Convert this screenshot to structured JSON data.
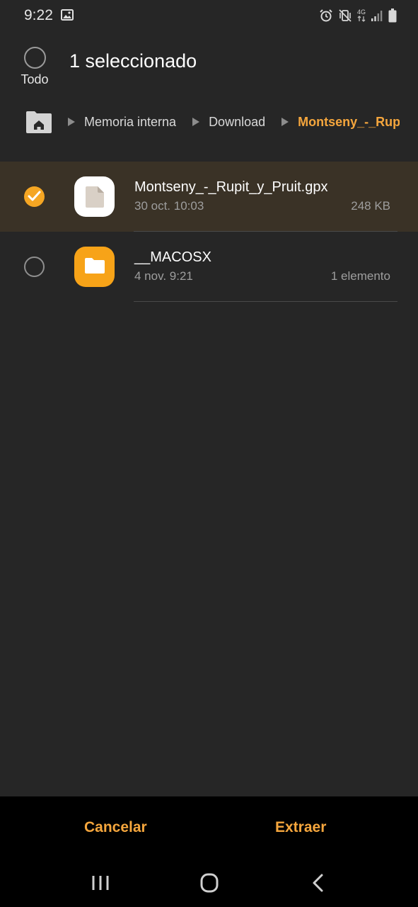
{
  "status_bar": {
    "time": "9:22",
    "network_label": "4G",
    "icons": [
      "image-icon",
      "alarm-icon",
      "vibrate-icon",
      "signal-icon",
      "battery-icon"
    ]
  },
  "header": {
    "select_all_label": "Todo",
    "title": "1 seleccionado"
  },
  "breadcrumb": {
    "items": [
      "Memoria interna",
      "Download",
      "Montseny_-_Rupit"
    ]
  },
  "files": [
    {
      "name": "Montseny_-_Rupit_y_Pruit.gpx",
      "date": "30 oct. 10:03",
      "meta": "248 KB",
      "type": "file",
      "selected": true
    },
    {
      "name": "__MACOSX",
      "date": "4 nov. 9:21",
      "meta": "1 elemento",
      "type": "folder",
      "selected": false
    }
  ],
  "actions": {
    "cancel": "Cancelar",
    "extract": "Extraer"
  },
  "colors": {
    "accent": "#f5a63d",
    "background": "#262626",
    "selected_row": "#3a3226",
    "folder": "#f7a318"
  }
}
